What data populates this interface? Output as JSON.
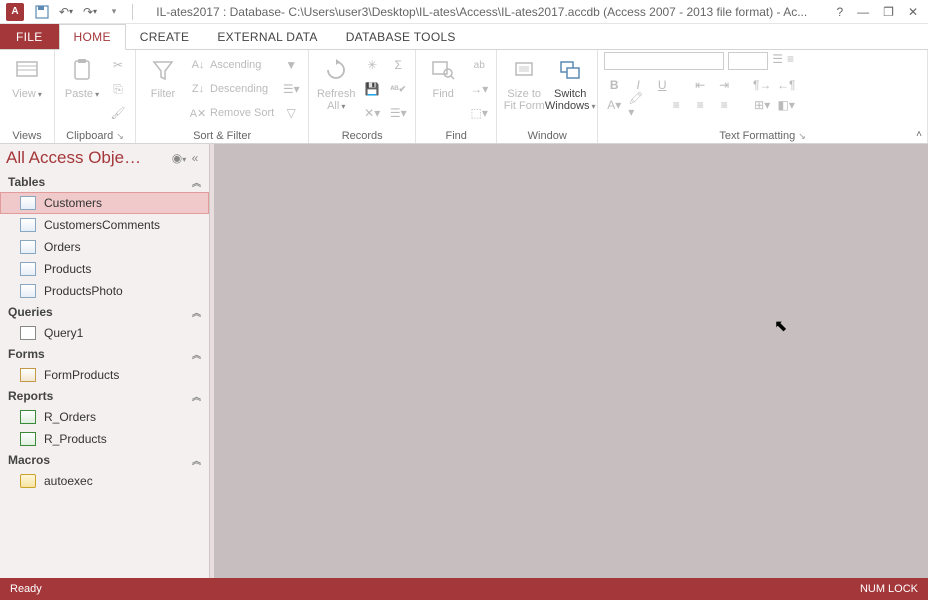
{
  "titlebar": {
    "title": "IL-ates2017 : Database- C:\\Users\\user3\\Desktop\\IL-ates\\Access\\IL-ates2017.accdb (Access 2007 - 2013 file format) - Ac...",
    "app_abbrev": "A"
  },
  "tabs": {
    "file": "FILE",
    "home": "HOME",
    "create": "CREATE",
    "external": "EXTERNAL DATA",
    "dbtools": "DATABASE TOOLS"
  },
  "ribbon": {
    "views": {
      "label": "Views",
      "view": "View"
    },
    "clipboard": {
      "label": "Clipboard",
      "paste": "Paste"
    },
    "sortfilter": {
      "label": "Sort & Filter",
      "filter": "Filter",
      "asc": "Ascending",
      "desc": "Descending",
      "remove": "Remove Sort"
    },
    "records": {
      "label": "Records",
      "refresh": "Refresh All"
    },
    "find": {
      "label": "Find",
      "find": "Find"
    },
    "window": {
      "label": "Window",
      "size": "Size to Fit Form",
      "switch": "Switch Windows"
    },
    "textfmt": {
      "label": "Text Formatting"
    }
  },
  "nav": {
    "title": "All Access Obje…",
    "cats": {
      "tables": "Tables",
      "queries": "Queries",
      "forms": "Forms",
      "reports": "Reports",
      "macros": "Macros"
    },
    "tables": [
      "Customers",
      "CustomersComments",
      "Orders",
      "Products",
      "ProductsPhoto"
    ],
    "queries": [
      "Query1"
    ],
    "forms": [
      "FormProducts"
    ],
    "reports": [
      "R_Orders",
      "R_Products"
    ],
    "macros": [
      "autoexec"
    ]
  },
  "status": {
    "ready": "Ready",
    "numlock": "NUM LOCK"
  }
}
